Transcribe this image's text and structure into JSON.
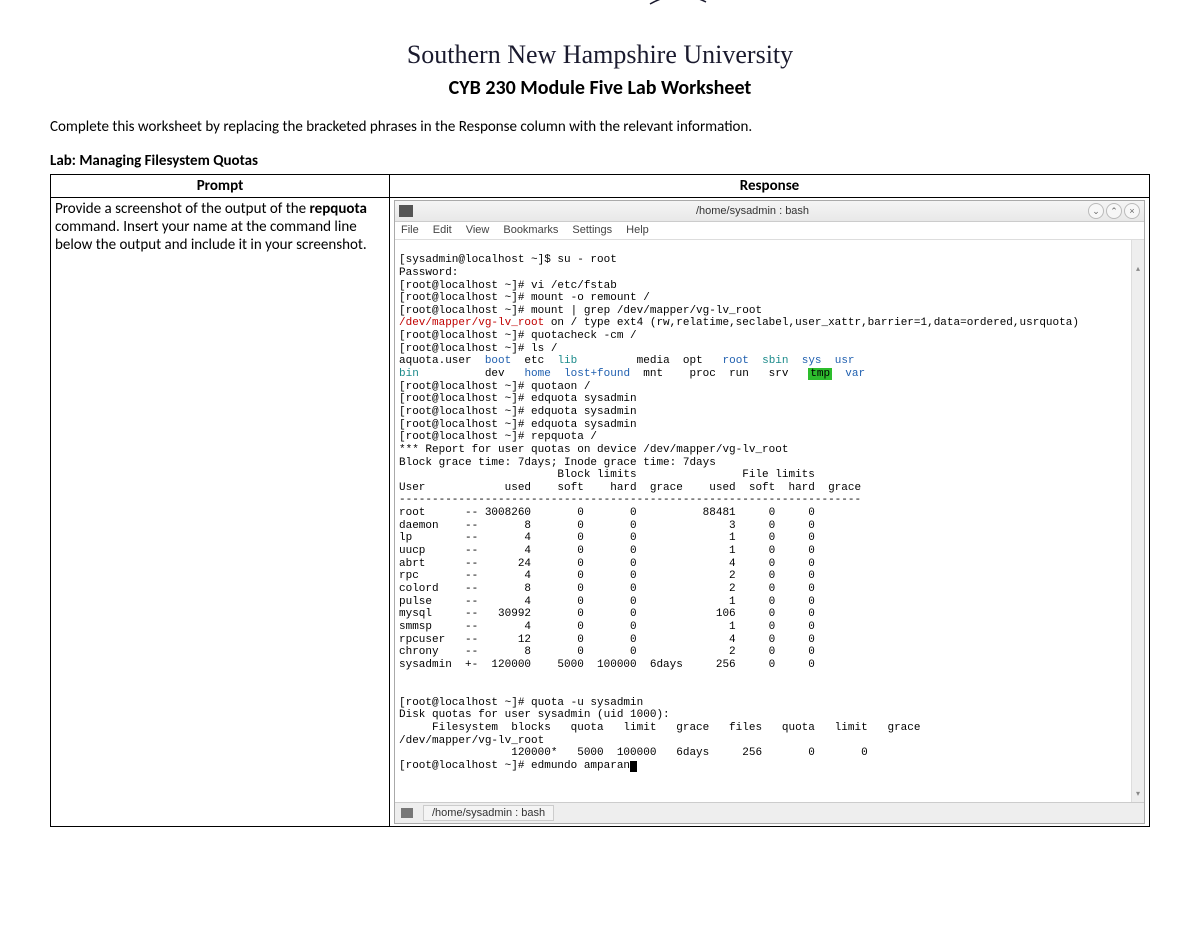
{
  "header": {
    "university": "Southern New Hampshire University",
    "doc_title": "CYB 230 Module Five Lab Worksheet",
    "instructions": "Complete this worksheet by replacing the bracketed phrases in the Response column with the relevant information.",
    "lab_title": "Lab: Managing Filesystem Quotas"
  },
  "table": {
    "col_prompt": "Prompt",
    "col_response": "Response",
    "prompt_pre": "Provide a screenshot of the output of the ",
    "prompt_bold": "repquota",
    "prompt_post": " command. Insert your name at the command line below the output and include it in your screenshot."
  },
  "window": {
    "title": "/home/sysadmin : bash",
    "min_glyph": "⌄",
    "up_glyph": "⌃",
    "close_glyph": "×",
    "menu": [
      "File",
      "Edit",
      "View",
      "Bookmarks",
      "Settings",
      "Help"
    ],
    "taskbar_item": "/home/sysadmin : bash"
  },
  "t": {
    "l1": "[sysadmin@localhost ~]$ su - root",
    "l2": "Password:",
    "l3": "[root@localhost ~]# vi /etc/fstab",
    "l4": "[root@localhost ~]# mount -o remount /",
    "l5": "[root@localhost ~]# mount | grep /dev/mapper/vg-lv_root",
    "l6a": "/dev/mapper/vg-lv_root",
    "l6b": " on / type ext4 (rw,relatime,seclabel,user_xattr,barrier=1,data=ordered,usrquota)",
    "l7": "[root@localhost ~]# quotacheck -cm /",
    "l8": "[root@localhost ~]# ls /",
    "ls_row1_a": "aquota.user  ",
    "ls_row1_boot": "boot",
    "ls_row1_etc": "  etc  ",
    "ls_row1_lib": "lib",
    "ls_row1_media": "         media  opt   ",
    "ls_row1_root": "root",
    "ls_row1_sbin": "  sbin  ",
    "ls_row1_sys": "sys",
    "ls_row1_usr": "  usr",
    "ls_row2_bin": "bin",
    "ls_row2_dev": "          dev   ",
    "ls_row2_home": "home",
    "ls_row2_lost": "  lost+found",
    "ls_row2_mnt": "  mnt    proc  run   srv   ",
    "ls_row2_tmp": "tmp",
    "ls_row2_var": "  var",
    "l11": "[root@localhost ~]# quotaon /",
    "l12": "[root@localhost ~]# edquota sysadmin",
    "l13": "[root@localhost ~]# edquota sysadmin",
    "l14": "[root@localhost ~]# edquota sysadmin",
    "l15": "[root@localhost ~]# repquota /",
    "l16": "*** Report for user quotas on device /dev/mapper/vg-lv_root",
    "l17": "Block grace time: 7days; Inode grace time: 7days",
    "l18": "                        Block limits                File limits",
    "l19": "User            used    soft    hard  grace    used  soft  hard  grace",
    "l20": "----------------------------------------------------------------------",
    "r_root": "root      -- 3008260       0       0          88481     0     0",
    "r_daemon": "daemon    --       8       0       0              3     0     0",
    "r_lp": "lp        --       4       0       0              1     0     0",
    "r_uucp": "uucp      --       4       0       0              1     0     0",
    "r_abrt": "abrt      --      24       0       0              4     0     0",
    "r_rpc": "rpc       --       4       0       0              2     0     0",
    "r_colord": "colord    --       8       0       0              2     0     0",
    "r_pulse": "pulse     --       4       0       0              1     0     0",
    "r_mysql": "mysql     --   30992       0       0            106     0     0",
    "r_smmsp": "smmsp     --       4       0       0              1     0     0",
    "r_rpcuser": "rpcuser   --      12       0       0              4     0     0",
    "r_chrony": "chrony    --       8       0       0              2     0     0",
    "r_sysadmin": "sysadmin  +-  120000    5000  100000  6days     256     0     0",
    "blank": "",
    "q1": "[root@localhost ~]# quota -u sysadmin",
    "q2": "Disk quotas for user sysadmin (uid 1000):",
    "q3": "     Filesystem  blocks   quota   limit   grace   files   quota   limit   grace",
    "q4": "/dev/mapper/vg-lv_root",
    "q5": "                 120000*   5000  100000   6days     256       0       0",
    "q6": "[root@localhost ~]# edmundo amparan"
  },
  "chart_data": {
    "type": "table",
    "title": "repquota / — user quotas on /dev/mapper/vg-lv_root",
    "block_grace": "7days",
    "inode_grace": "7days",
    "columns": [
      "User",
      "flags",
      "block_used",
      "block_soft",
      "block_hard",
      "block_grace",
      "file_used",
      "file_soft",
      "file_hard",
      "file_grace"
    ],
    "rows": [
      [
        "root",
        "--",
        3008260,
        0,
        0,
        "",
        88481,
        0,
        0,
        ""
      ],
      [
        "daemon",
        "--",
        8,
        0,
        0,
        "",
        3,
        0,
        0,
        ""
      ],
      [
        "lp",
        "--",
        4,
        0,
        0,
        "",
        1,
        0,
        0,
        ""
      ],
      [
        "uucp",
        "--",
        4,
        0,
        0,
        "",
        1,
        0,
        0,
        ""
      ],
      [
        "abrt",
        "--",
        24,
        0,
        0,
        "",
        4,
        0,
        0,
        ""
      ],
      [
        "rpc",
        "--",
        4,
        0,
        0,
        "",
        2,
        0,
        0,
        ""
      ],
      [
        "colord",
        "--",
        8,
        0,
        0,
        "",
        2,
        0,
        0,
        ""
      ],
      [
        "pulse",
        "--",
        4,
        0,
        0,
        "",
        1,
        0,
        0,
        ""
      ],
      [
        "mysql",
        "--",
        30992,
        0,
        0,
        "",
        106,
        0,
        0,
        ""
      ],
      [
        "smmsp",
        "--",
        4,
        0,
        0,
        "",
        1,
        0,
        0,
        ""
      ],
      [
        "rpcuser",
        "--",
        12,
        0,
        0,
        "",
        4,
        0,
        0,
        ""
      ],
      [
        "chrony",
        "--",
        8,
        0,
        0,
        "",
        2,
        0,
        0,
        ""
      ],
      [
        "sysadmin",
        "+-",
        120000,
        5000,
        100000,
        "6days",
        256,
        0,
        0,
        ""
      ]
    ],
    "quota_u_sysadmin": {
      "uid": 1000,
      "filesystem": "/dev/mapper/vg-lv_root",
      "blocks": "120000*",
      "quota": 5000,
      "limit": 100000,
      "grace": "6days",
      "files": 256,
      "file_quota": 0,
      "file_limit": 0,
      "file_grace": ""
    }
  }
}
